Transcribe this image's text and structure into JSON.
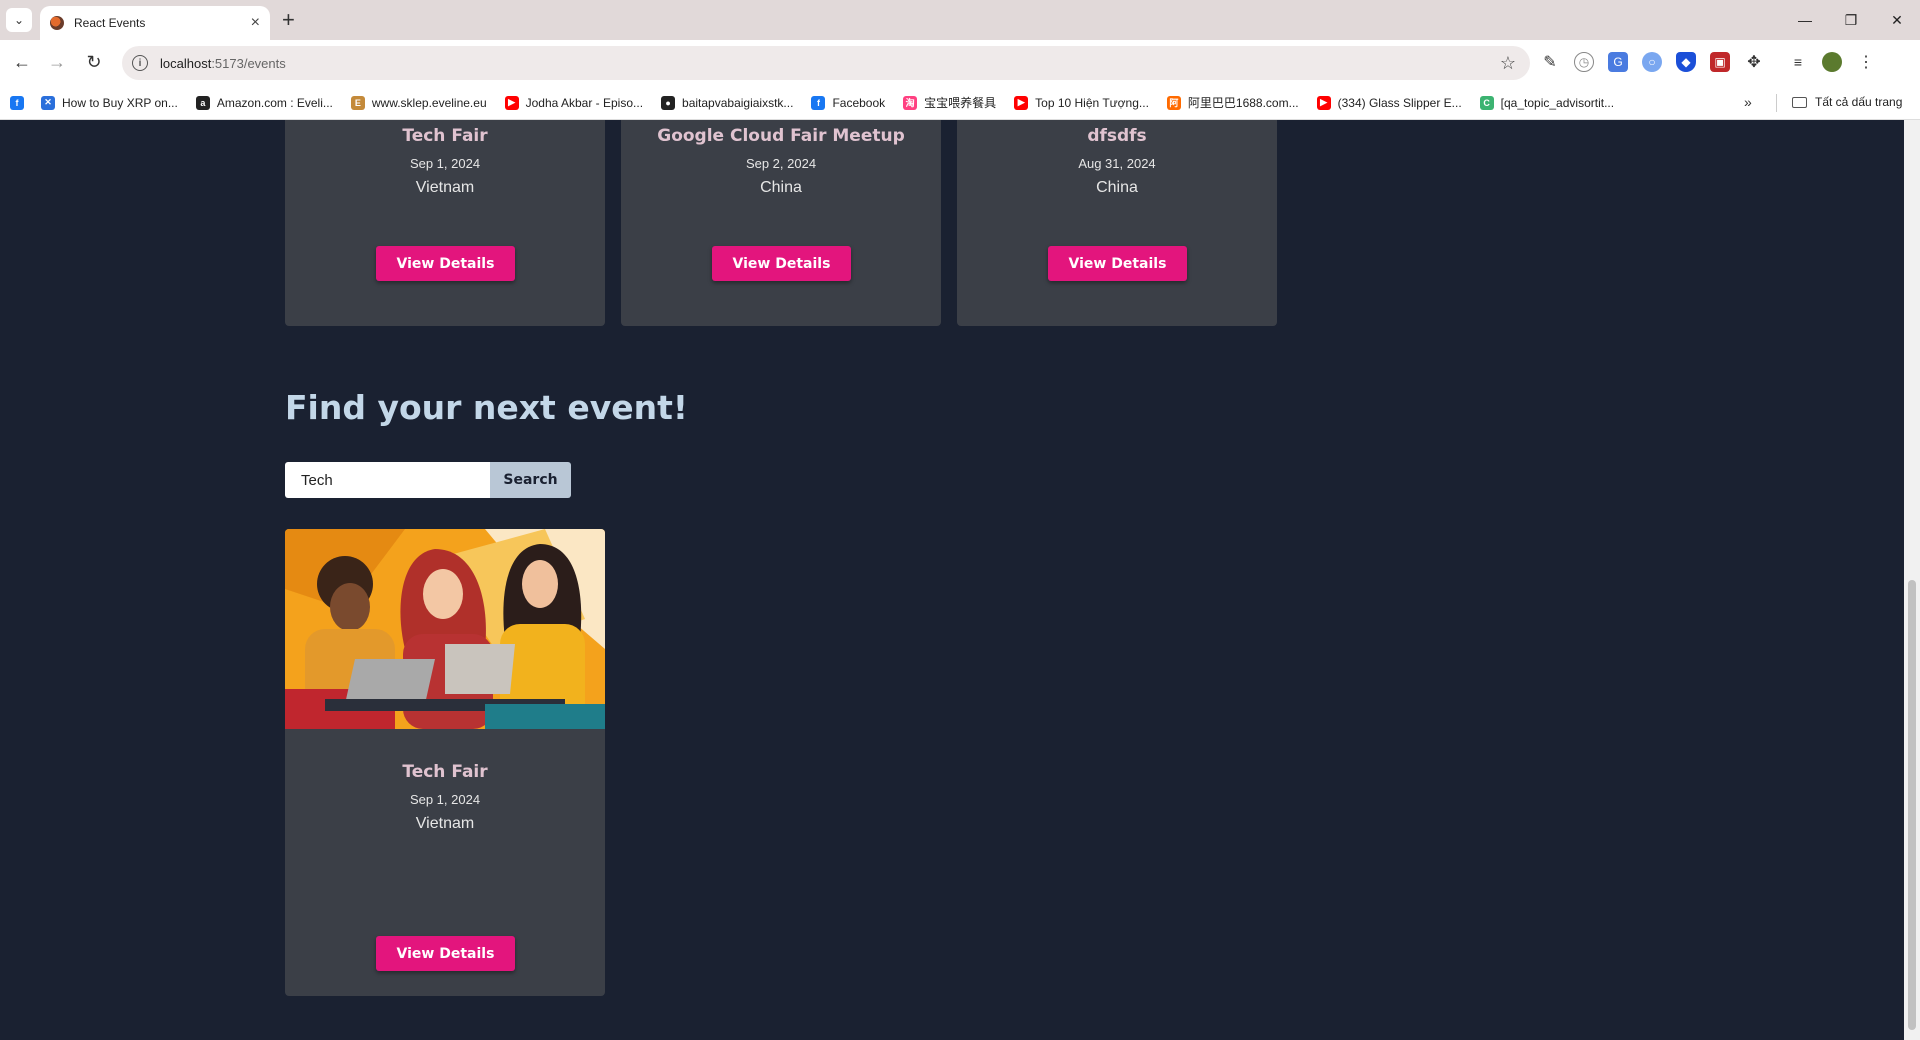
{
  "browser": {
    "tab_title": "React Events",
    "url_host": "localhost",
    "url_path": ":5173/events",
    "bookmarks": [
      {
        "label": "",
        "icon": "facebook-icon",
        "color": "#1877f2"
      },
      {
        "label": "How to Buy XRP on...",
        "icon": "xrp-icon",
        "color": "#2a6fdb"
      },
      {
        "label": "Amazon.com : Eveli...",
        "icon": "amazon-icon",
        "color": "#222222"
      },
      {
        "label": "www.sklep.eveline.eu",
        "icon": "eveline-icon",
        "color": "#c48a3a"
      },
      {
        "label": "Jodha Akbar - Episo...",
        "icon": "youtube-icon",
        "color": "#ff0000"
      },
      {
        "label": "baitapvabaigiaixstk...",
        "icon": "globe-icon",
        "color": "#222222"
      },
      {
        "label": "Facebook",
        "icon": "facebook-icon",
        "color": "#1877f2"
      },
      {
        "label": "宝宝喂养餐具",
        "icon": "taobao-icon",
        "color": "#ff4081"
      },
      {
        "label": "Top 10 Hiện Tượng...",
        "icon": "youtube-icon",
        "color": "#ff0000"
      },
      {
        "label": "阿里巴巴1688.com...",
        "icon": "alibaba-icon",
        "color": "#ff6a00"
      },
      {
        "label": "(334) Glass Slipper E...",
        "icon": "youtube-icon",
        "color": "#ff0000"
      },
      {
        "label": "[qa_topic_advisortit...",
        "icon": "cx-icon",
        "color": "#3cb371"
      }
    ],
    "all_bookmarks_label": "Tất cả dấu trang"
  },
  "top_cards": [
    {
      "title": "Tech Fair",
      "date": "Sep 1, 2024",
      "location": "Vietnam",
      "button": "View Details"
    },
    {
      "title": "Google Cloud Fair Meetup",
      "date": "Sep 2, 2024",
      "location": "China",
      "button": "View Details"
    },
    {
      "title": "dfsdfs",
      "date": "Aug 31, 2024",
      "location": "China",
      "button": "View Details"
    }
  ],
  "search_section": {
    "title": "Find your next event!",
    "input_value": "Tech",
    "button_label": "Search"
  },
  "results": [
    {
      "title": "Tech Fair",
      "date": "Sep 1, 2024",
      "location": "Vietnam",
      "button": "View Details",
      "image": "three-women-with-laptops-illustration"
    }
  ],
  "colors": {
    "page_bg": "#1a2131",
    "card_bg": "#3b3f47",
    "accent": "#e3157d",
    "title_text": "#e0c3d0"
  }
}
